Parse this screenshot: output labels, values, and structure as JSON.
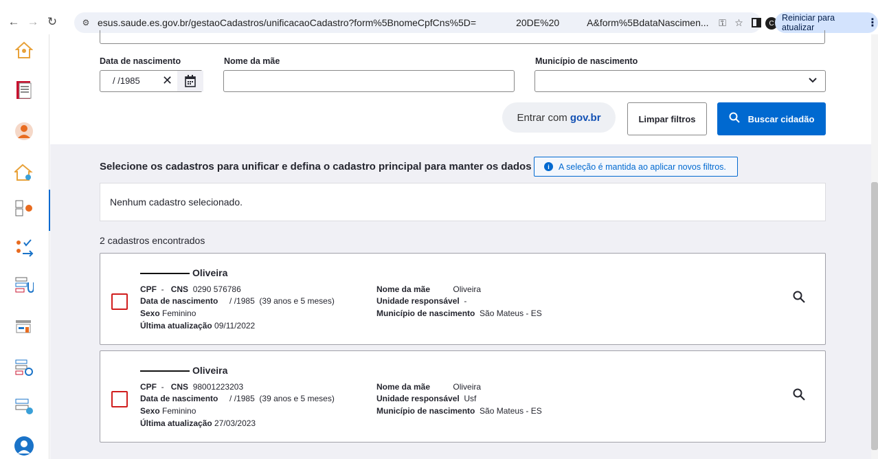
{
  "browser": {
    "url_part1": "esus.saude.es.gov.br/gestaoCadastros/unificacaoCadastro?form%5BnomeCpfCns%5D=",
    "url_part2": "20DE%20",
    "url_part3": "A&form%5BdataNascimen...",
    "profile_initial": "C",
    "update_label": "Reiniciar para atualizar"
  },
  "filters": {
    "birth_label": "Data de nascimento",
    "birth_value": "/ /1985",
    "mother_label": "Nome da mãe",
    "mother_value": "",
    "municipality_label": "Município de nascimento",
    "municipality_value": "",
    "govbr_prefix": "Entrar com",
    "govbr_brand": "gov.br",
    "clear_label": "Limpar filtros",
    "search_label": "Buscar cidadão"
  },
  "results": {
    "instruction": "Selecione os cadastros para unificar e defina o cadastro principal para manter os dados",
    "info_text": "A seleção é mantida ao aplicar novos filtros.",
    "selected_text": "Nenhum cadastro selecionado.",
    "found_text": "2 cadastros encontrados",
    "records": [
      {
        "name": "Oliveira",
        "cpf_label": "CPF",
        "cpf_value": "-",
        "cns_label": "CNS",
        "cns_value": "0290 576786",
        "birth_label": "Data de nascimento",
        "birth_value": "/ /1985",
        "age": "(39 anos e 5 meses)",
        "sex_label": "Sexo",
        "sex_value": "Feminino",
        "updated_label": "Última atualização",
        "updated_value": "09/11/2022",
        "mother_label": "Nome da mãe",
        "mother_value": "Oliveira",
        "unit_label": "Unidade responsável",
        "unit_value": "-",
        "municipality_label": "Município de nascimento",
        "municipality_value": "São Mateus - ES"
      },
      {
        "name": "Oliveira",
        "cpf_label": "CPF",
        "cpf_value": "-",
        "cns_label": "CNS",
        "cns_value": "98001223203",
        "birth_label": "Data de nascimento",
        "birth_value": "/ /1985",
        "age": "(39 anos e 5 meses)",
        "sex_label": "Sexo",
        "sex_value": "Feminino",
        "updated_label": "Última atualização",
        "updated_value": "27/03/2023",
        "mother_label": "Nome da mãe",
        "mother_value": "Oliveira",
        "unit_label": "Unidade responsável",
        "unit_value": "Usf",
        "municipality_label": "Município de nascimento",
        "municipality_value": "São Mateus - ES"
      }
    ]
  },
  "colors": {
    "primary": "#0069d0",
    "checkbox_border": "#d01c1c",
    "background_gray": "#f0f0f5"
  }
}
